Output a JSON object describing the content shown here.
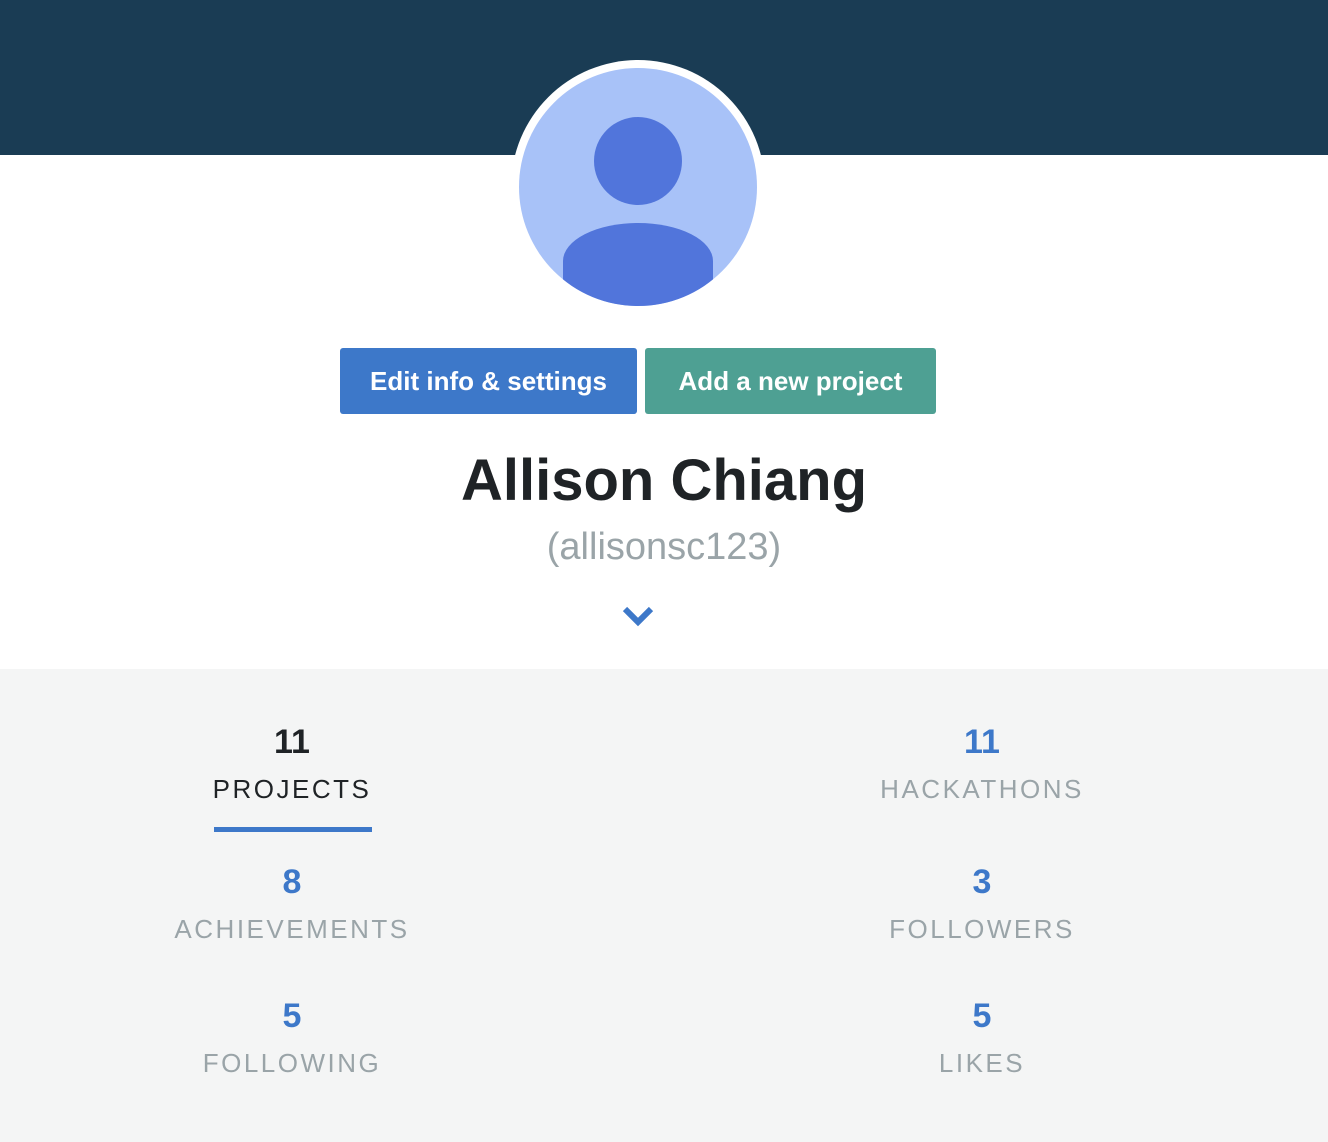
{
  "profile": {
    "name": "Allison Chiang",
    "username": "(allisonsc123)",
    "avatar_icon": "default-user-avatar-icon"
  },
  "actions": {
    "edit_label": "Edit info & settings",
    "add_label": "Add a new project"
  },
  "colors": {
    "header_band": "#1a3c54",
    "edit_button": "#3d78c9",
    "add_button": "#4ea093",
    "accent_blue": "#3d78c9",
    "muted_text": "#9aa4a8",
    "stats_background": "#f4f5f5"
  },
  "expand_icon": "chevron-down-icon",
  "stats": {
    "projects": {
      "count": "11",
      "label": "PROJECTS",
      "active": true
    },
    "hackathons": {
      "count": "11",
      "label": "HACKATHONS",
      "active": false
    },
    "achievements": {
      "count": "8",
      "label": "ACHIEVEMENTS",
      "active": false
    },
    "followers": {
      "count": "3",
      "label": "FOLLOWERS",
      "active": false
    },
    "following": {
      "count": "5",
      "label": "FOLLOWING",
      "active": false
    },
    "likes": {
      "count": "5",
      "label": "LIKES",
      "active": false
    }
  }
}
